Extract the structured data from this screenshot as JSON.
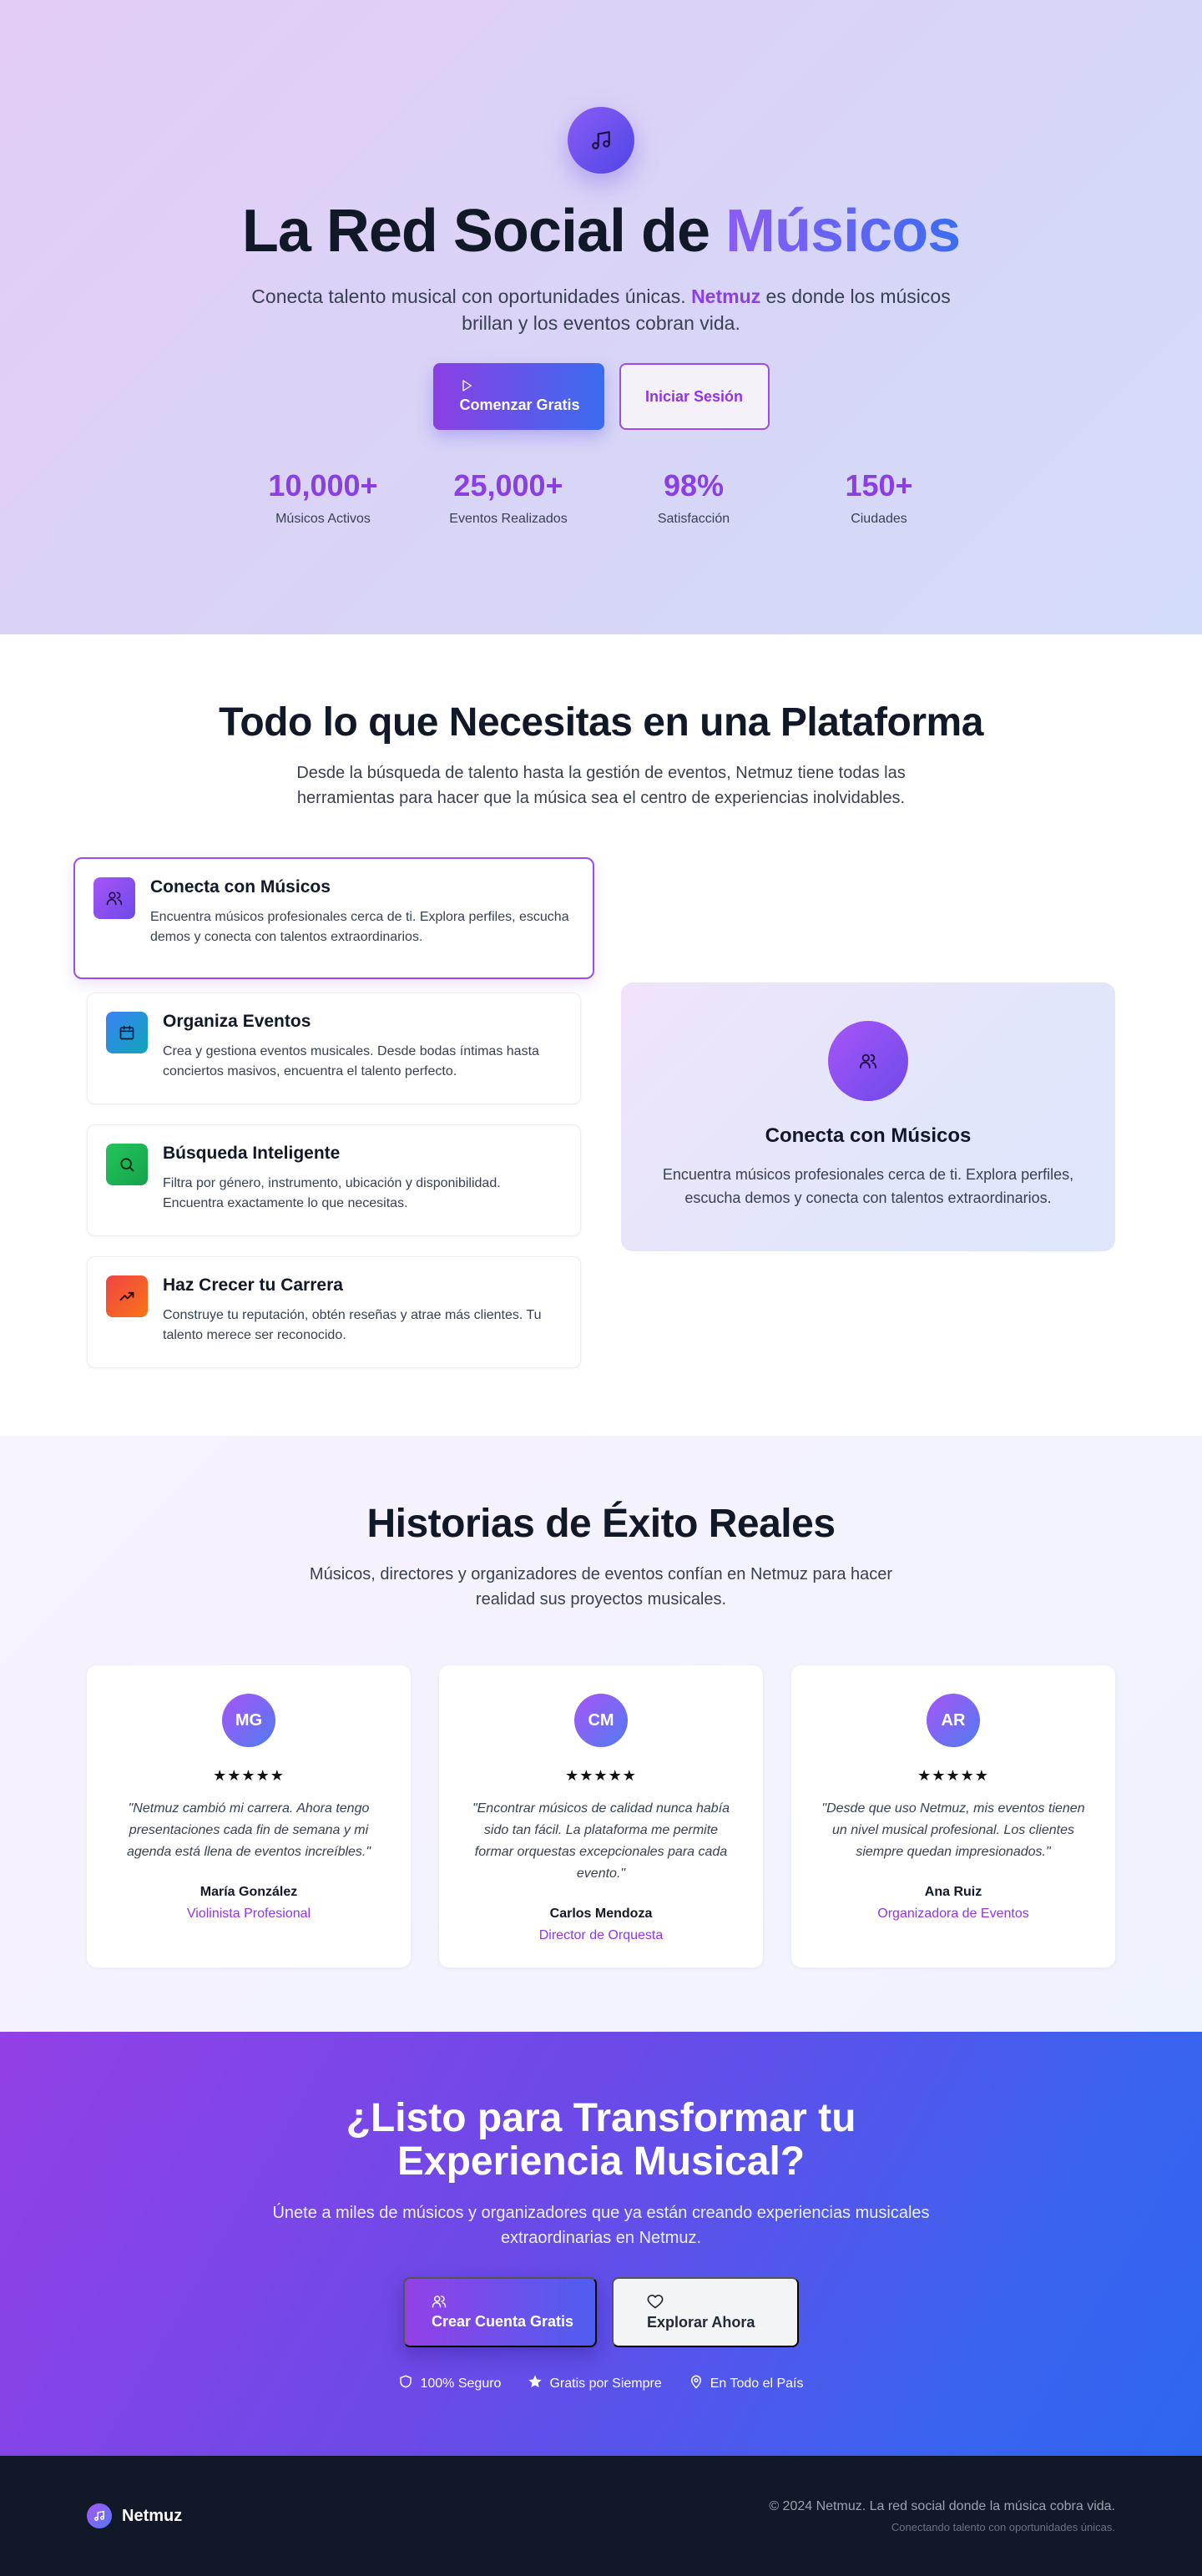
{
  "hero": {
    "title_main": "La Red Social de ",
    "title_accent": "Músicos",
    "subtitle_before": "Conecta talento musical con oportunidades únicas. ",
    "subtitle_brand": "Netmuz",
    "subtitle_after": " es donde los músicos brillan y los eventos cobran vida.",
    "primary_button": "Comenzar Gratis",
    "secondary_button": "Iniciar Sesión",
    "stats": [
      {
        "value": "10,000+",
        "label": "Músicos Activos"
      },
      {
        "value": "25,000+",
        "label": "Eventos Realizados"
      },
      {
        "value": "98%",
        "label": "Satisfacción"
      },
      {
        "value": "150+",
        "label": "Ciudades"
      }
    ]
  },
  "features": {
    "title": "Todo lo que Necesitas en una Plataforma",
    "subtitle": "Desde la búsqueda de talento hasta la gestión de eventos, Netmuz tiene todas las herramientas para hacer que la música sea el centro de experiencias inolvidables.",
    "items": [
      {
        "title": "Conecta con Músicos",
        "desc": "Encuentra músicos profesionales cerca de ti. Explora perfiles, escucha demos y conecta con talentos extraordinarios.",
        "icon": "users-icon",
        "color": "#8b5cf6"
      },
      {
        "title": "Organiza Eventos",
        "desc": "Crea y gestiona eventos musicales. Desde bodas íntimas hasta conciertos masivos, encuentra el talento perfecto.",
        "icon": "calendar-icon",
        "color": "#3b82f6"
      },
      {
        "title": "Búsqueda Inteligente",
        "desc": "Filtra por género, instrumento, ubicación y disponibilidad. Encuentra exactamente lo que necesitas.",
        "icon": "search-icon",
        "color": "#22c55e"
      },
      {
        "title": "Haz Crecer tu Carrera",
        "desc": "Construye tu reputación, obtén reseñas y atrae más clientes. Tu talento merece ser reconocido.",
        "icon": "trending-up-icon",
        "color": "#ef4444"
      }
    ],
    "preview": {
      "title": "Conecta con Músicos",
      "desc": "Encuentra músicos profesionales cerca de ti. Explora perfiles, escucha demos y conecta con talentos extraordinarios."
    }
  },
  "testimonials": {
    "title": "Historias de Éxito Reales",
    "subtitle": "Músicos, directores y organizadores de eventos confían en Netmuz para hacer realidad sus proyectos musicales.",
    "items": [
      {
        "initials": "MG",
        "stars": "★★★★★",
        "quote": "\"Netmuz cambió mi carrera. Ahora tengo presentaciones cada fin de semana y mi agenda está llena de eventos increíbles.\"",
        "name": "María González",
        "role": "Violinista Profesional"
      },
      {
        "initials": "CM",
        "stars": "★★★★★",
        "quote": "\"Encontrar músicos de calidad nunca había sido tan fácil. La plataforma me permite formar orquestas excepcionales para cada evento.\"",
        "name": "Carlos Mendoza",
        "role": "Director de Orquesta"
      },
      {
        "initials": "AR",
        "stars": "★★★★★",
        "quote": "\"Desde que uso Netmuz, mis eventos tienen un nivel musical profesional. Los clientes siempre quedan impresionados.\"",
        "name": "Ana Ruiz",
        "role": "Organizadora de Eventos"
      }
    ]
  },
  "cta": {
    "title": "¿Listo para Transformar tu Experiencia Musical?",
    "subtitle": "Únete a miles de músicos y organizadores que ya están creando experiencias musicales extraordinarias en Netmuz.",
    "primary_button": "Crear Cuenta Gratis",
    "secondary_button": "Explorar Ahora",
    "badges": [
      {
        "label": "100% Seguro",
        "icon": "shield-icon"
      },
      {
        "label": "Gratis por Siempre",
        "icon": "star-icon"
      },
      {
        "label": "En Todo el País",
        "icon": "map-pin-icon"
      }
    ]
  },
  "footer": {
    "brand": "Netmuz",
    "copyright": "© 2024 Netmuz. La red social donde la música cobra vida.",
    "tagline": "Conectando talento con oportunidades únicas."
  }
}
